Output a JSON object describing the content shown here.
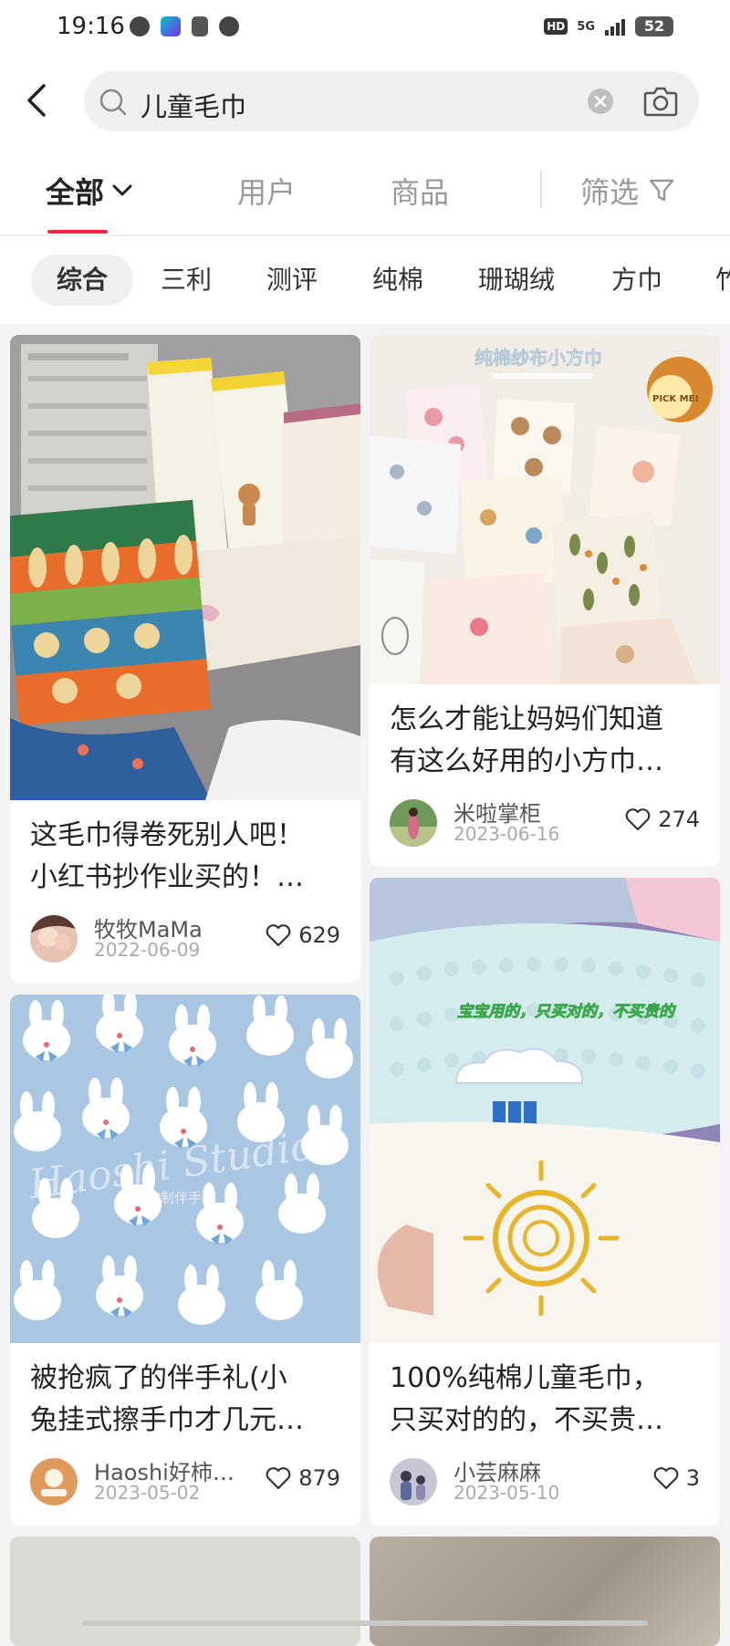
{
  "status_bar": {
    "time": "19:16",
    "hd": "HD",
    "network": "5G",
    "battery": "52"
  },
  "search": {
    "query": "儿童毛巾"
  },
  "tabs": [
    {
      "label": "全部"
    },
    {
      "label": "用户"
    },
    {
      "label": "商品"
    },
    {
      "label": "筛选"
    }
  ],
  "chips": [
    {
      "label": "综合"
    },
    {
      "label": "三利"
    },
    {
      "label": "测评"
    },
    {
      "label": "纯棉"
    },
    {
      "label": "珊瑚绒"
    },
    {
      "label": "方巾"
    },
    {
      "label": "竹"
    }
  ],
  "image_texts": {
    "cotton_gauze_title": "纯棉纱布小方巾",
    "pick_me": "PICK ME!",
    "towel_caption": "宝宝用的，只买对的，不买贵的",
    "watermark": "Haoshi Studio",
    "watermark_sub": "好柿定制伴手礼"
  },
  "posts": [
    {
      "title_line1": "这毛巾得卷死别人吧！",
      "title_line2": "小红书抄作业买的！…",
      "author": "牧牧MaMa",
      "date": "2022-06-09",
      "likes": "629"
    },
    {
      "title_line1": "怎么才能让妈妈们知道",
      "title_line2": "有这么好用的小方巾…",
      "author": "米啦掌柜",
      "date": "2023-06-16",
      "likes": "274"
    },
    {
      "title_line1": "被抢疯了的伴手礼(小",
      "title_line2": "兔挂式擦手巾才几元…",
      "author": "Haoshi好柿…",
      "date": "2023-05-02",
      "likes": "879"
    },
    {
      "title_line1": "100%纯棉儿童毛巾，",
      "title_line2": "只买对的的，不买贵…",
      "author": "小芸麻麻",
      "date": "2023-05-10",
      "likes": "3"
    }
  ],
  "colors": {
    "accent": "#ff2442"
  }
}
